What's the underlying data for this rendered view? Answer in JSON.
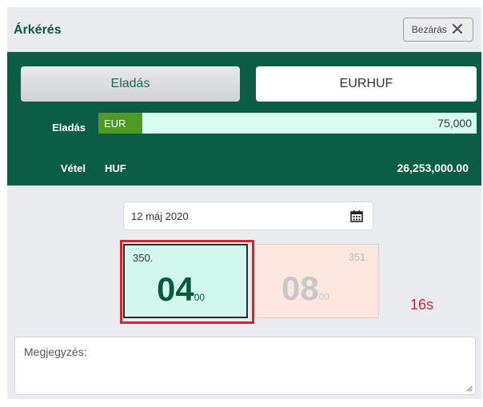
{
  "header": {
    "title": "Árkérés",
    "close_label": "Bezárás"
  },
  "trade": {
    "direction_button": "Eladás",
    "pair_button": "EURHUF",
    "sell": {
      "label": "Eladás",
      "currency": "EUR",
      "amount": "75,000"
    },
    "buy": {
      "label": "Vétel",
      "currency": "HUF",
      "amount": "26,253,000.00"
    }
  },
  "date": {
    "value": "12 máj 2020"
  },
  "quotes": {
    "sell": {
      "big_figure": "350.",
      "pips": "04",
      "fraction": "00"
    },
    "buy": {
      "big_figure": "351.",
      "pips": "08",
      "fraction": "00"
    }
  },
  "timer": "16s",
  "note": {
    "placeholder": "Megjegyzés:"
  },
  "colors": {
    "brand_green": "#0b5e43",
    "currency_badge": "#4f9a22",
    "sell_quote_bg": "#d2f8ee",
    "buy_quote_bg": "#fde6dd",
    "highlight_red": "#d9232d",
    "timer_red": "#c42a35"
  },
  "icons": {
    "close": "close-icon",
    "calendar": "calendar-icon",
    "resize": "resize-grip-icon"
  }
}
